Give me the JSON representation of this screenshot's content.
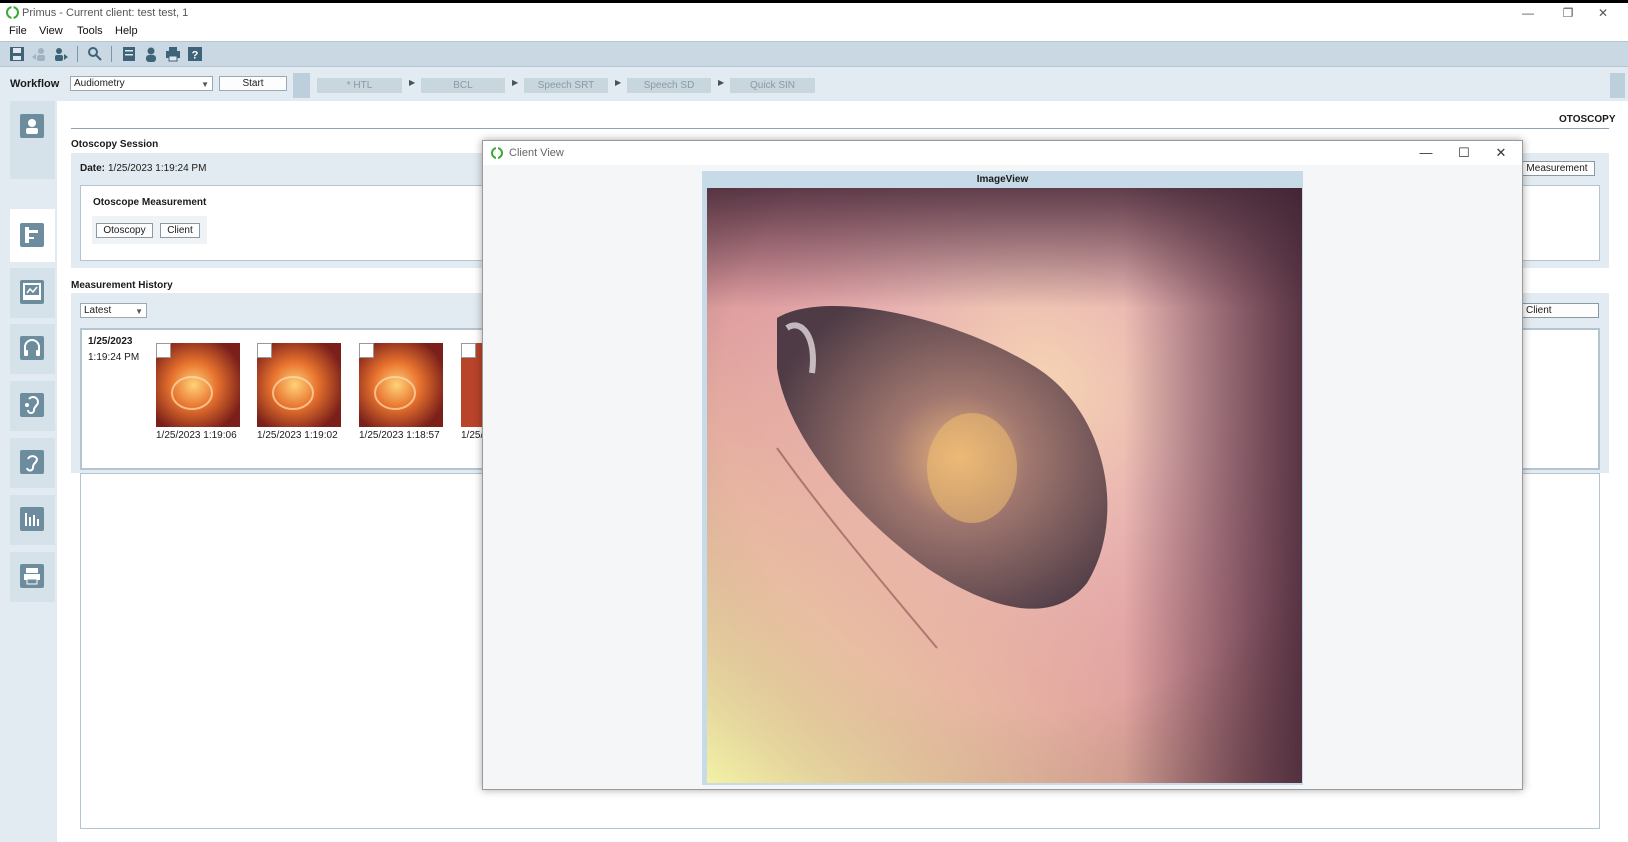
{
  "window": {
    "title": "Primus - Current client: test test, 1",
    "controls": [
      "—",
      "❐",
      "✕"
    ]
  },
  "menu": [
    "File",
    "View",
    "Tools",
    "Help"
  ],
  "toolbar_icons": [
    "save-icon",
    "client-back-icon",
    "client-forward-icon",
    "search-client-icon",
    "notes-icon",
    "client-icon",
    "print-icon",
    "help-icon"
  ],
  "workflow": {
    "label": "Workflow",
    "selected": "Audiometry",
    "start_label": "Start",
    "steps": [
      "* HTL",
      "BCL",
      "Speech SRT",
      "Speech SD",
      "Quick SIN"
    ]
  },
  "sidebar_icons": [
    "client-icon",
    "otoscope-icon",
    "audiometer-icon",
    "headphones-icon",
    "hearing-aid-icon",
    "ear-icon",
    "chart-icon",
    "printer-device-icon"
  ],
  "page": {
    "header": "OTOSCOPY",
    "session_title": "Otoscopy Session",
    "date_label": "Date:",
    "date_value": "1/25/2023 1:19:24 PM",
    "measurement_button": "Measurement",
    "measurement_title": "Otoscope Measurement",
    "otoscopy_button": "Otoscopy",
    "client_button": "Client",
    "history_title": "Measurement History",
    "history_filter": "Latest",
    "history_client_button": "Client",
    "history_date": "1/25/2023",
    "history_time": "1:19:24 PM",
    "thumbs": [
      {
        "caption": "1/25/2023 1:19:06"
      },
      {
        "caption": "1/25/2023 1:19:02"
      },
      {
        "caption": "1/25/2023 1:18:57"
      },
      {
        "caption": "1/25/"
      }
    ]
  },
  "client_view": {
    "title": "Client View",
    "image_title": "ImageView",
    "controls": [
      "—",
      "☐",
      "✕"
    ]
  },
  "colors": {
    "toolbar": "#c9d8e2",
    "panel": "#e2ebf1",
    "icon": "#6d8c9e",
    "logo": "#3aaa35"
  }
}
